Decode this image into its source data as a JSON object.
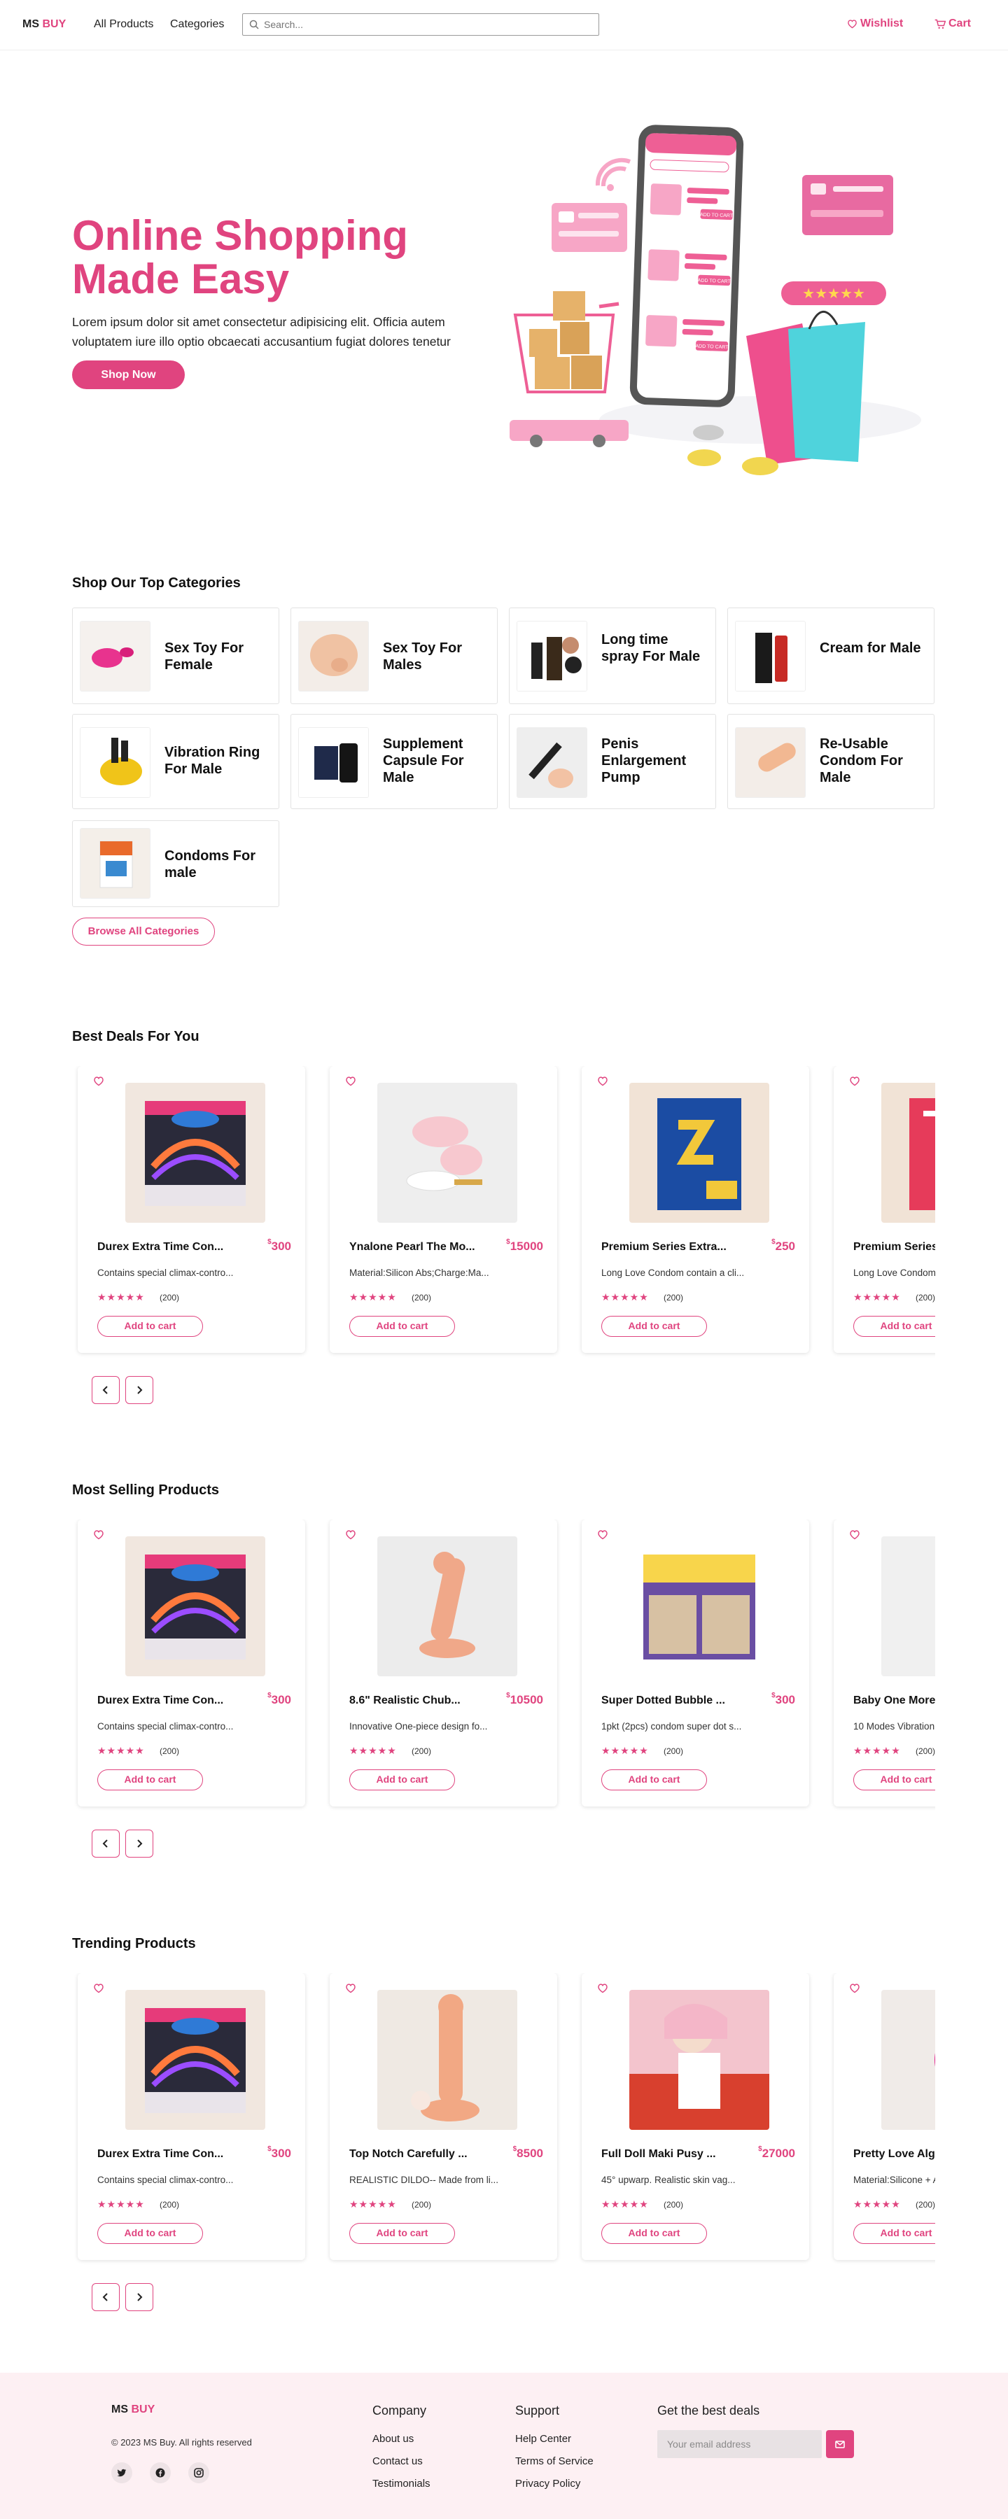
{
  "header": {
    "logo_a": "MS",
    "logo_b": "BUY",
    "nav": [
      "All Products",
      "Categories"
    ],
    "search_placeholder": "Search...",
    "wishlist": "Wishlist",
    "cart": "Cart"
  },
  "hero": {
    "title": "Online Shopping Made Easy",
    "text": "Lorem ipsum dolor sit amet consectetur adipisicing elit. Officia autem voluptatem iure illo optio obcaecati accusantium fugiat dolores tenetur",
    "button": "Shop Now",
    "art_buttons": [
      "ADD TO CART",
      "ADD TO CART",
      "ADD TO CART"
    ]
  },
  "categories": {
    "title": "Shop Our Top Categories",
    "items": [
      "Sex Toy For Female",
      "Sex Toy For Males",
      "Long time spray For Male",
      "Cream for Male",
      "Vibration Ring For Male",
      "Supplement Capsule For Male",
      "Penis Enlargement Pump",
      "Re-Usable Condom For Male",
      "Condoms For male"
    ],
    "browse_button": "Browse All Categories"
  },
  "best_deals": {
    "title": "Best Deals For You",
    "products": [
      {
        "name": "Durex Extra Time Con...",
        "price": "300",
        "desc": "Contains special climax-contro...",
        "rating": "(200)",
        "button": "Add to cart"
      },
      {
        "name": "Ynalone Pearl The Mo...",
        "price": "15000",
        "desc": "Material:Silicon Abs;Charge:Ma...",
        "rating": "(200)",
        "button": "Add to cart"
      },
      {
        "name": "Premium Series Extra...",
        "price": "250",
        "desc": "Long Love Condom contain a cli...",
        "rating": "(200)",
        "button": "Add to cart"
      },
      {
        "name": "Premium Series",
        "price": "",
        "desc": "Long Love Condom",
        "rating": "(200)",
        "button": "Add to cart"
      }
    ]
  },
  "most_selling": {
    "title": "Most Selling Products",
    "products": [
      {
        "name": "Durex Extra Time Con...",
        "price": "300",
        "desc": "Contains special climax-contro...",
        "rating": "(200)",
        "button": "Add to cart"
      },
      {
        "name": "8.6\" Realistic Chub...",
        "price": "10500",
        "desc": "Innovative One-piece design fo...",
        "rating": "(200)",
        "button": "Add to cart"
      },
      {
        "name": "Super Dotted Bubble ...",
        "price": "300",
        "desc": "1pkt (2pcs) condom super dot s...",
        "rating": "(200)",
        "button": "Add to cart"
      },
      {
        "name": "Baby One More T",
        "price": "",
        "desc": "10 Modes Vibration",
        "rating": "(200)",
        "button": "Add to cart"
      }
    ]
  },
  "trending": {
    "title": "Trending Products",
    "products": [
      {
        "name": "Durex Extra Time Con...",
        "price": "300",
        "desc": "Contains special climax-contro...",
        "rating": "(200)",
        "button": "Add to cart"
      },
      {
        "name": "Top Notch Carefully ...",
        "price": "8500",
        "desc": "REALISTIC DILDO-- Made from li...",
        "rating": "(200)",
        "button": "Add to cart"
      },
      {
        "name": "Full Doll Maki Pusy ...",
        "price": "27000",
        "desc": "45° upwarp. Realistic skin vag...",
        "rating": "(200)",
        "button": "Add to cart"
      },
      {
        "name": "Pretty Love Alge",
        "price": "",
        "desc": "Material:Silicone + A",
        "rating": "(200)",
        "button": "Add to cart"
      }
    ]
  },
  "stars": "★★★★★",
  "currency": "$",
  "footer": {
    "logo_a": "MS",
    "logo_b": "BUY",
    "copyright": "© 2023 MS Buy. All rights reserved",
    "company_title": "Company",
    "company_links": [
      "About us",
      "Contact us",
      "Testimonials"
    ],
    "support_title": "Support",
    "support_links": [
      "Help Center",
      "Terms of Service",
      "Privacy Policy"
    ],
    "deals_title": "Get the best deals",
    "email_placeholder": "Your email address"
  },
  "colors": {
    "accent": "#e0447f",
    "footer_bg": "#fdf0f3",
    "teal": "#4fd3dc"
  }
}
